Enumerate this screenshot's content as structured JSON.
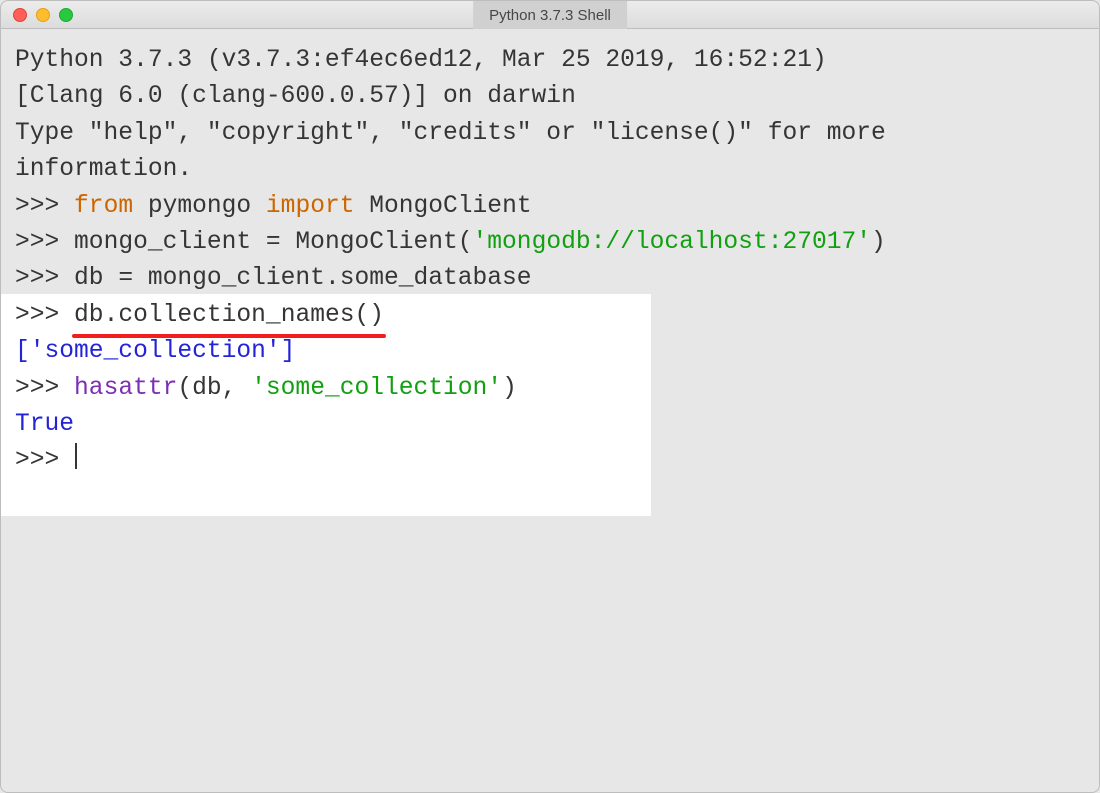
{
  "window": {
    "title": "Python 3.7.3 Shell"
  },
  "shell": {
    "banner_l1": "Python 3.7.3 (v3.7.3:ef4ec6ed12, Mar 25 2019, 16:52:21)",
    "banner_l2": "[Clang 6.0 (clang-600.0.57)] on darwin",
    "banner_l3a": "Type \"help\", \"copyright\", \"credits\" or \"license()\" for more",
    "banner_l3b": "information.",
    "prompt": ">>> ",
    "line1": {
      "kw_from": "from",
      "pkg": " pymongo ",
      "kw_import": "import",
      "name": " MongoClient"
    },
    "line2": {
      "assign": "mongo_client = MongoClient(",
      "str": "'mongodb://localhost:27017'",
      "close": ")"
    },
    "line3": "db = mongo_client.some_database",
    "line4": {
      "obj": "db",
      "dot": ".",
      "call": "collection_names()"
    },
    "out1": "['some_collection']",
    "line5": {
      "fn": "hasattr",
      "args_open": "(db, ",
      "str": "'some_collection'",
      "args_close": ")"
    },
    "out2": "True"
  }
}
